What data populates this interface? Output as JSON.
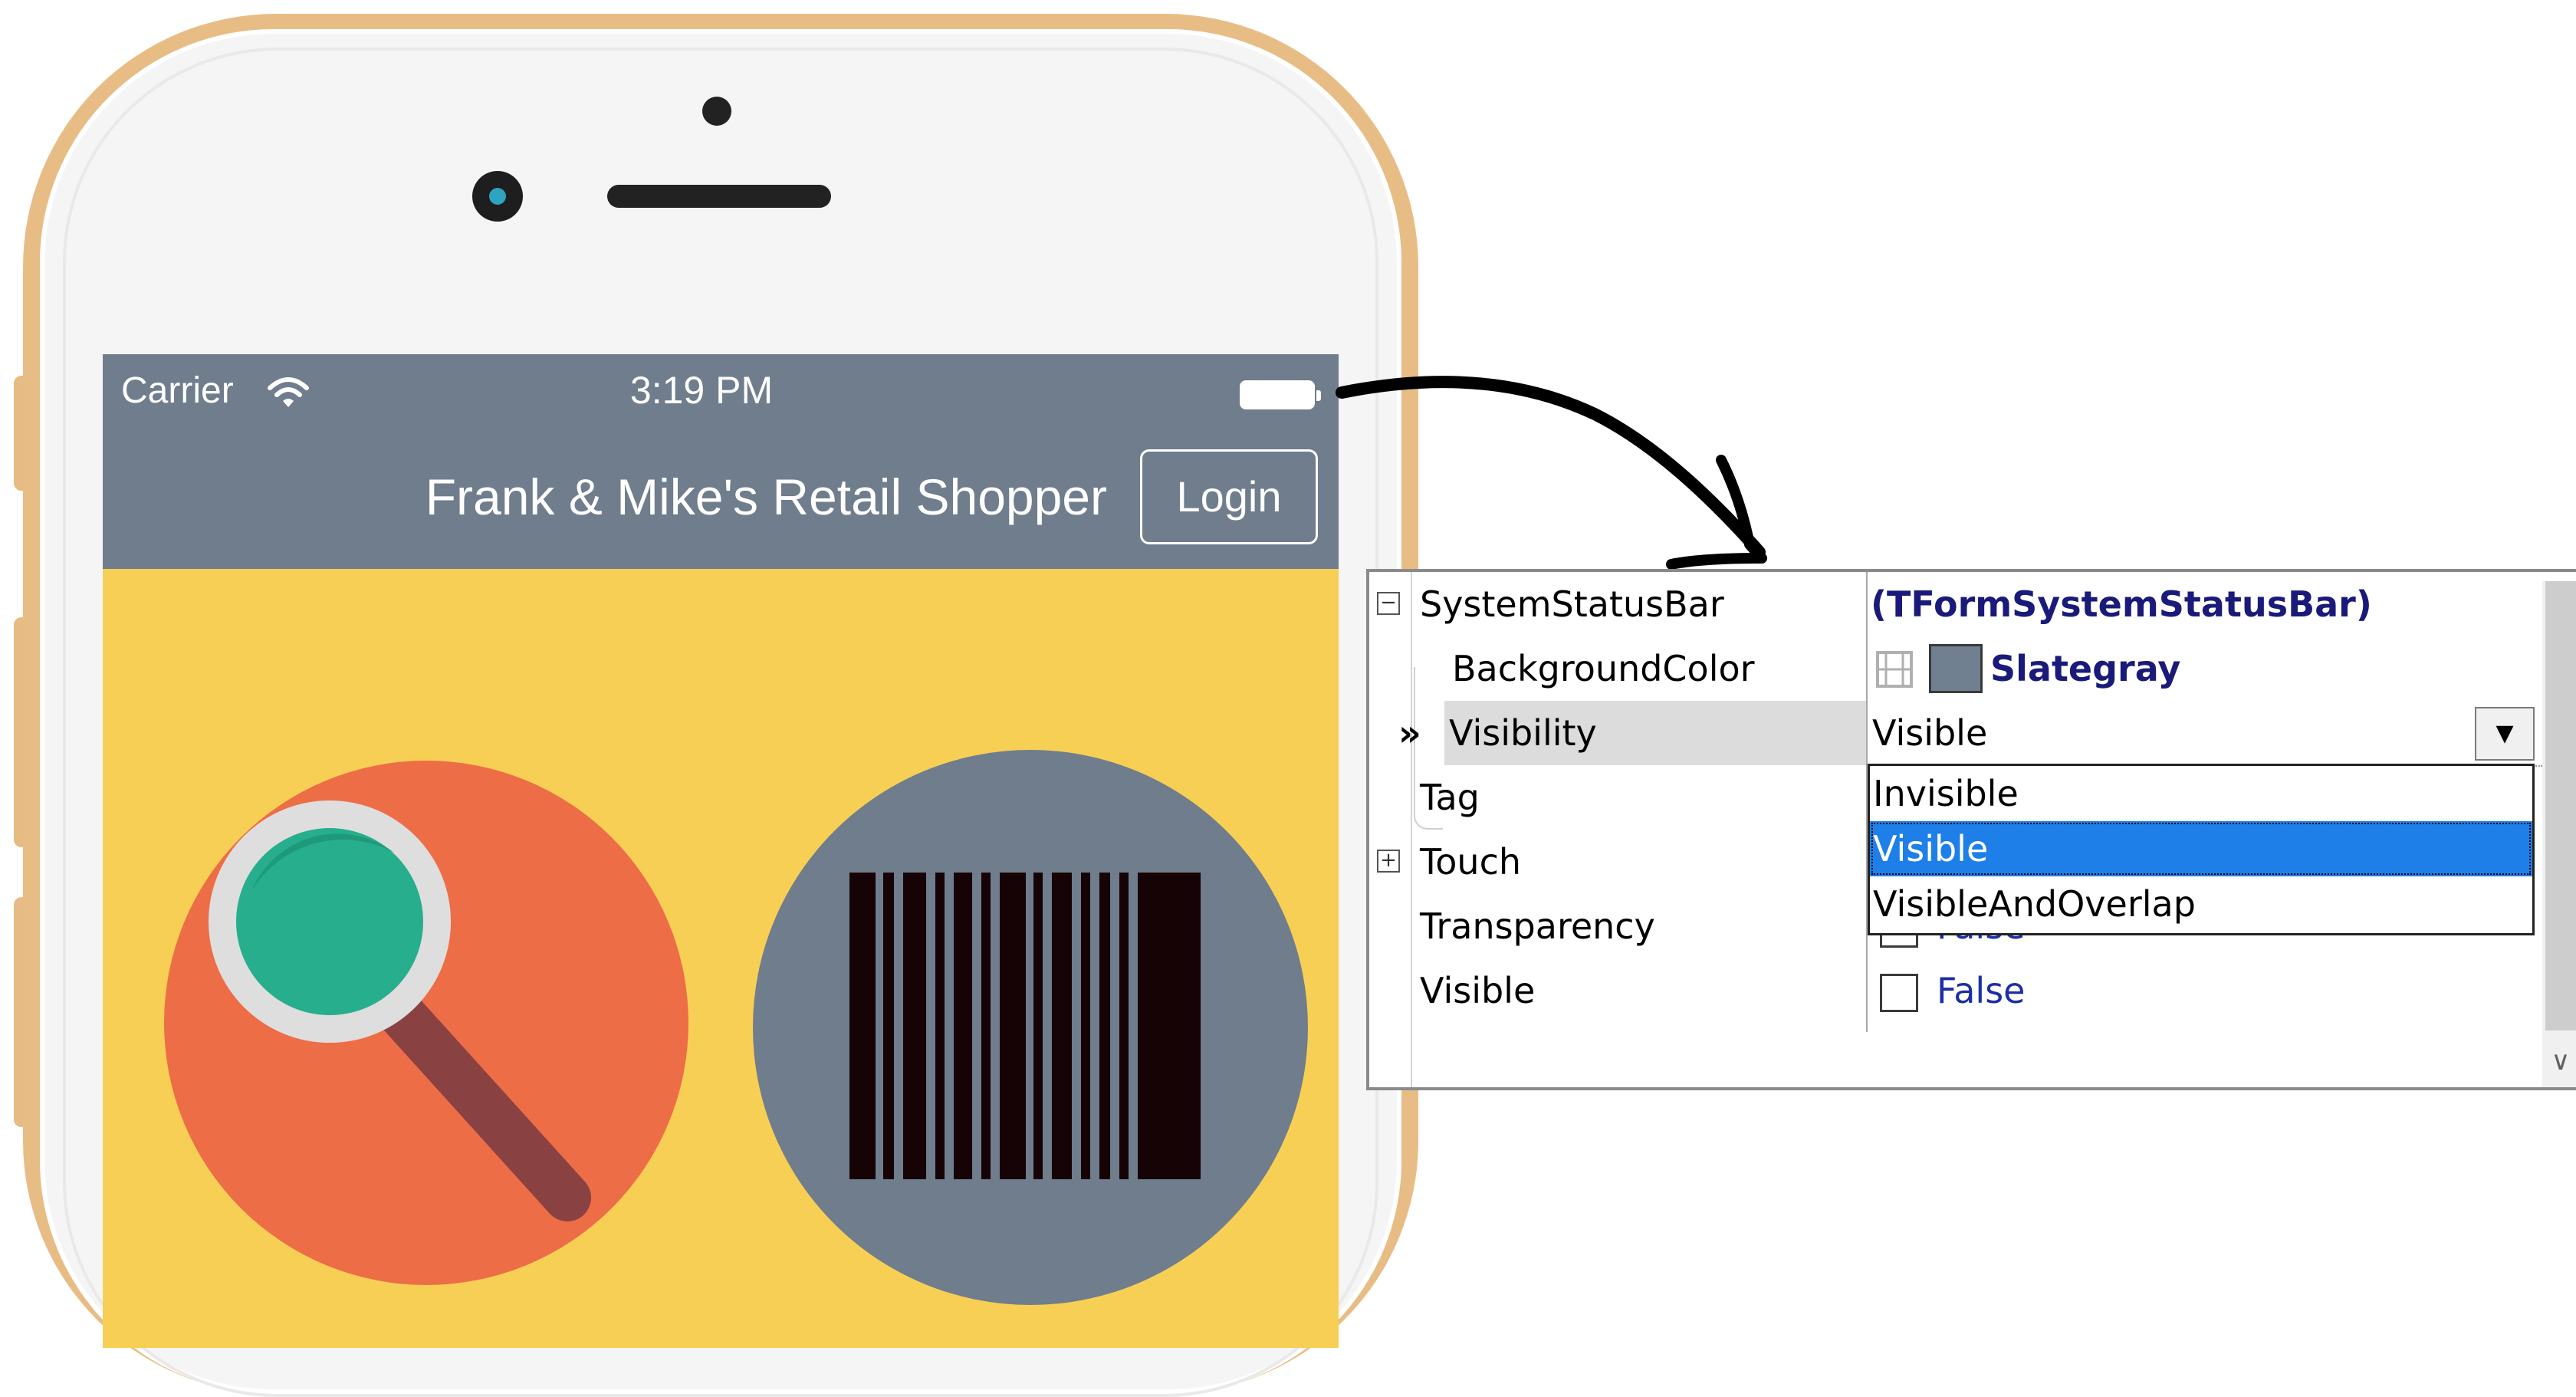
{
  "phone": {
    "status_bar": {
      "carrier": "Carrier",
      "time": "3:19 PM",
      "wifi_icon": "wifi-icon",
      "battery_icon": "battery-icon"
    },
    "nav": {
      "title": "Frank & Mike's Retail Shopper",
      "login_label": "Login"
    },
    "tiles": [
      {
        "icon": "magnifier-icon"
      },
      {
        "icon": "barcode-icon"
      }
    ],
    "colors": {
      "status_bar_bg": "#6f7d8c",
      "screen_bg": "#f8cf55",
      "search_circle": "#ed6d47",
      "barcode_circle": "#6f7d8c",
      "lens": "#27ae8c",
      "frame_gold": "#e8bd85"
    }
  },
  "inspector": {
    "rows": [
      {
        "name": "SystemStatusBar",
        "value": "(TFormSystemStatusBar)",
        "expander": "−"
      },
      {
        "name": "BackgroundColor",
        "value": "Slategray"
      },
      {
        "name": "Visibility",
        "value": "Visible",
        "marker": "»"
      },
      {
        "name": "Tag",
        "value": ""
      },
      {
        "name": "Touch",
        "value": "",
        "expander": "+"
      },
      {
        "name": "Transparency",
        "value": "False"
      },
      {
        "name": "Visible",
        "value": "False"
      }
    ],
    "visibility_dropdown": {
      "options": [
        "Invisible",
        "Visible",
        "VisibleAndOverlap"
      ],
      "selected": "Visible"
    },
    "colors": {
      "slategray": "#708090",
      "selection": "#1e7fe8",
      "bold_value": "#1a1a7a",
      "false_value": "#1b2fa8"
    }
  }
}
